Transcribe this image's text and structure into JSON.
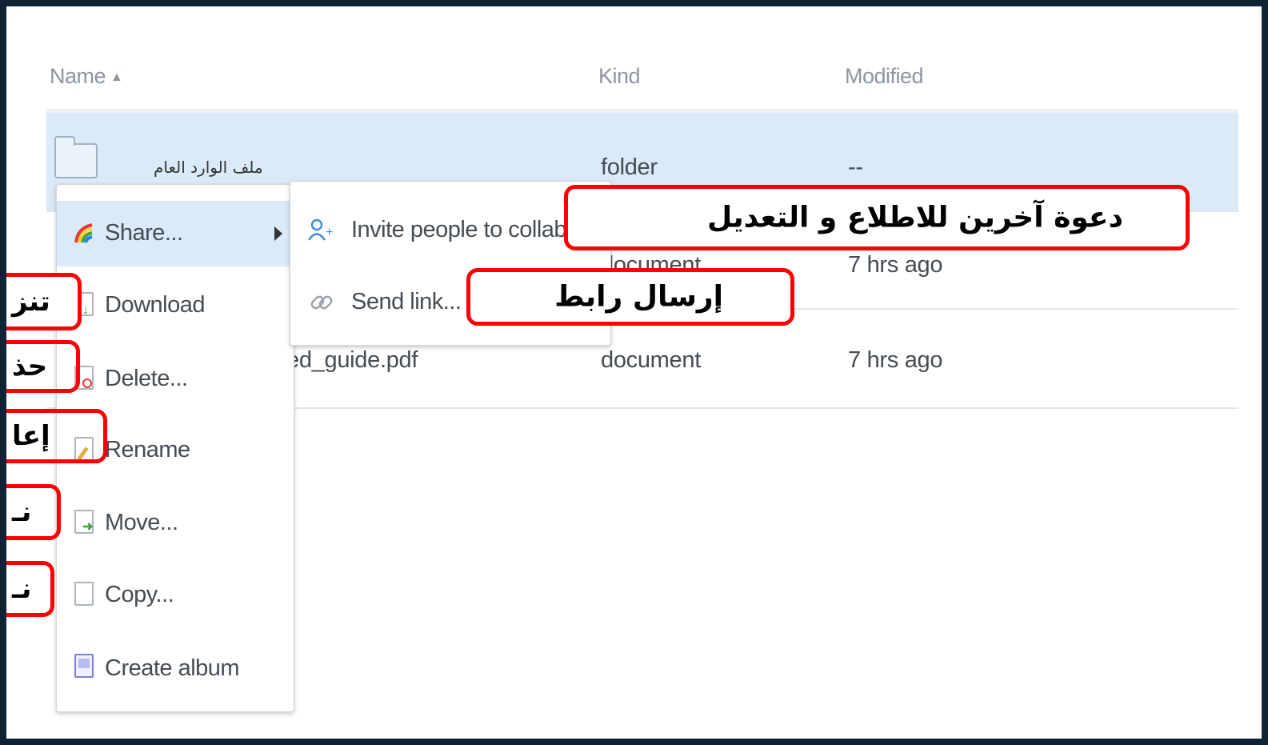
{
  "columns": {
    "name": "Name",
    "sort_indicator": "▲",
    "kind": "Kind",
    "modified": "Modified"
  },
  "rows": [
    {
      "name": "ملف الوارد العام",
      "kind": "folder",
      "modified": "--"
    },
    {
      "name": "",
      "kind": "document",
      "modified": "7 hrs ago"
    },
    {
      "name": "ed_guide.pdf",
      "kind": "document",
      "modified": "7 hrs ago"
    }
  ],
  "context_menu": {
    "items": [
      {
        "label": "Share...",
        "icon": "rainbow-share-icon"
      },
      {
        "label": "Download",
        "icon": "download-icon"
      },
      {
        "label": "Delete...",
        "icon": "delete-icon"
      },
      {
        "label": "Rename",
        "icon": "rename-icon"
      },
      {
        "label": "Move...",
        "icon": "move-icon"
      },
      {
        "label": "Copy...",
        "icon": "copy-icon"
      },
      {
        "label": "Create album",
        "icon": "album-icon"
      }
    ]
  },
  "share_submenu": {
    "items": [
      {
        "label": "Invite people to collabor",
        "icon": "invite-person-icon"
      },
      {
        "label": "Send link...",
        "icon": "link-icon"
      }
    ]
  },
  "annotations": {
    "invite": "دعوة آخرين للاطلاع و التعديل",
    "send_link": "إرسال رابط",
    "download": "تنز",
    "delete": "حذ",
    "rename": "إعا",
    "move": "نـ",
    "copy": "نـ"
  },
  "colors": {
    "selection": "#dbeaf8",
    "callout_border": "#ff0000",
    "frame_border": "#0f2236"
  }
}
